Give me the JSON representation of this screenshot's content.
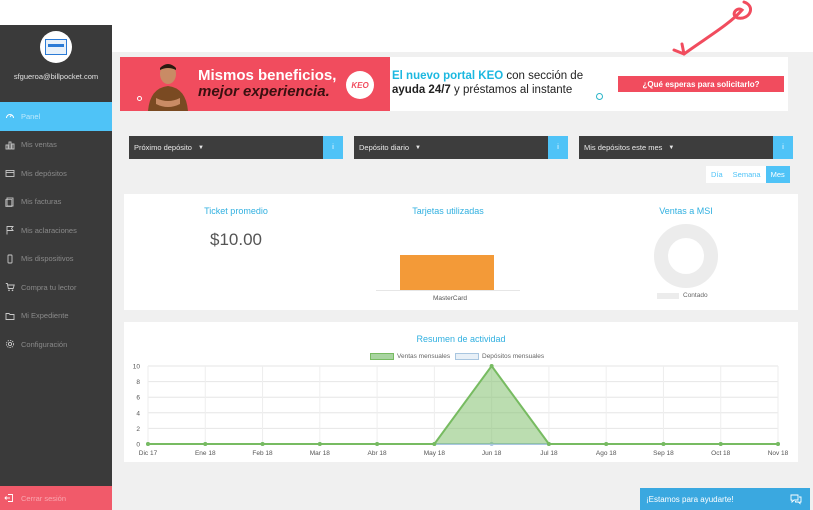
{
  "sidebar": {
    "email": "sfgueroa@billpocket.com",
    "items": [
      {
        "label": "Panel",
        "icon": "gauge-icon",
        "active": true
      },
      {
        "label": "Mis ventas",
        "icon": "bar-chart-icon"
      },
      {
        "label": "Mis depósitos",
        "icon": "wallet-icon"
      },
      {
        "label": "Mis facturas",
        "icon": "document-icon"
      },
      {
        "label": "Mis aclaraciones",
        "icon": "flag-icon"
      },
      {
        "label": "Mis dispositivos",
        "icon": "phone-icon"
      },
      {
        "label": "Compra tu lector",
        "icon": "cart-icon"
      },
      {
        "label": "Mi Expediente",
        "icon": "folder-icon"
      },
      {
        "label": "Configuración",
        "icon": "gear-icon"
      }
    ],
    "logout": "Cerrar sesión"
  },
  "banner": {
    "headline_1": "Mismos beneficios,",
    "headline_2": "mejor experiencia.",
    "keo": "KEO",
    "text_highlight": "El nuevo portal KEO",
    "text_1": " con sección de",
    "text_bold": "ayuda 24/7",
    "text_2": " y préstamos al instante",
    "cta": "¿Qué esperas para solicitarlo?"
  },
  "filters": {
    "next_deposit": "Próximo depósito",
    "daily_deposit": "Depósito diario",
    "monthly_deposits": "Mis depósitos este mes",
    "info": "i"
  },
  "period": {
    "day": "Día",
    "week": "Semana",
    "month": "Mes",
    "selected": "Mes"
  },
  "stats": {
    "ticket_title": "Ticket promedio",
    "ticket_value": "$10.00",
    "cards_title": "Tarjetas utilizadas",
    "cards_bar_label": "MasterCard",
    "msi_title": "Ventas a MSI",
    "msi_legend": "Contado"
  },
  "colors": {
    "accent": "#4fc3f7",
    "brand_red": "#f14c5e",
    "bar_orange": "#f39a38",
    "series_ventas": "#77bb61",
    "series_depositos": "#cfe2f3"
  },
  "chart_data": {
    "type": "area",
    "title": "Resumen de actividad",
    "categories": [
      "Dic 17",
      "Ene 18",
      "Feb 18",
      "Mar 18",
      "Abr 18",
      "May 18",
      "Jun 18",
      "Jul 18",
      "Ago 18",
      "Sep 18",
      "Oct 18",
      "Nov 18"
    ],
    "series": [
      {
        "name": "Ventas mensuales",
        "values": [
          0,
          0,
          0,
          0,
          0,
          0,
          10,
          0,
          0,
          0,
          0,
          0
        ]
      },
      {
        "name": "Depósitos mensuales",
        "values": [
          0,
          0,
          0,
          0,
          0,
          0,
          0,
          0,
          0,
          0,
          0,
          0
        ]
      }
    ],
    "yticks": [
      0,
      2,
      4,
      6,
      8,
      10
    ],
    "ylim": [
      0,
      10
    ],
    "grid": true,
    "legend": "top-center"
  },
  "help": {
    "label": "¡Estamos para ayudarte!"
  }
}
